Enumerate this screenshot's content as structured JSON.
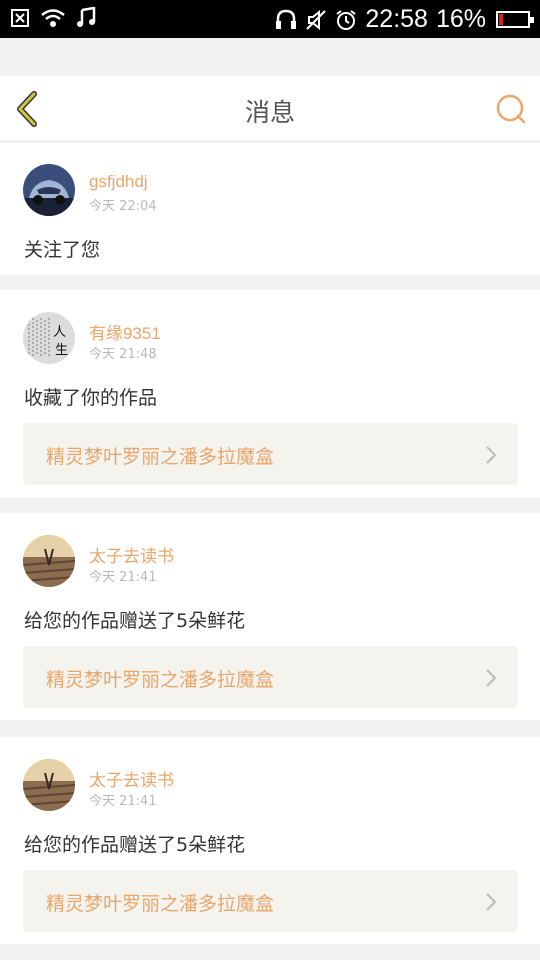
{
  "status_bar": {
    "time": "22:58",
    "battery": "16%",
    "battery_level": 0.16
  },
  "nav": {
    "title": "消息"
  },
  "messages": [
    {
      "username": "gsfjdhdj",
      "time": "今天 22:04",
      "action": "关注了您"
    },
    {
      "username": "有缘9351",
      "time": "今天 21:48",
      "action": "收藏了你的作品",
      "work_title": "精灵梦叶罗丽之潘多拉魔盒"
    },
    {
      "username": "太子去读书",
      "time": "今天 21:41",
      "action": "给您的作品赠送了5朵鲜花",
      "work_title": "精灵梦叶罗丽之潘多拉魔盒"
    },
    {
      "username": "太子去读书",
      "time": "今天 21:41",
      "action": "给您的作品赠送了5朵鲜花",
      "work_title": "精灵梦叶罗丽之潘多拉魔盒"
    }
  ],
  "avatar_seal_text": "人生",
  "colors": {
    "accent": "#e9a66b",
    "back_arrow": "#c9c33a",
    "card_background": "#ffffff",
    "page_background": "#f2f2f2",
    "work_box": "#f4f3ee"
  },
  "icons": [
    "close-box-icon",
    "wifi-icon",
    "music-icon",
    "headphones-icon",
    "mute-icon",
    "alarm-icon",
    "battery-icon",
    "back-arrow-icon",
    "search-icon",
    "chevron-right-icon"
  ]
}
